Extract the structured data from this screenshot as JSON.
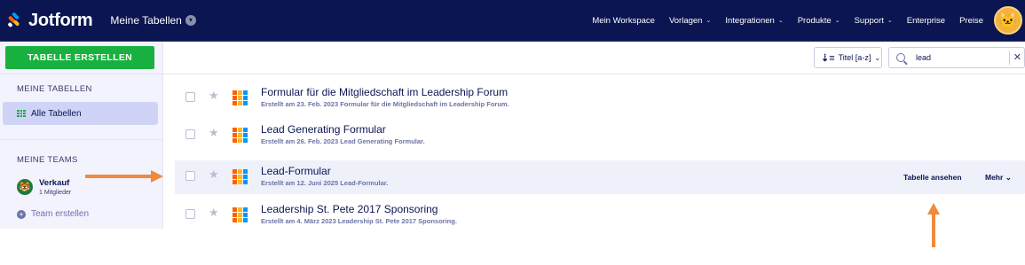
{
  "header": {
    "logo_text": "Jotform",
    "breadcrumb": "Meine Tabellen",
    "nav": [
      "Mein Workspace",
      "Vorlagen",
      "Integrationen",
      "Produkte",
      "Support",
      "Enterprise",
      "Preise"
    ],
    "nav_dropdown": [
      false,
      true,
      true,
      true,
      true,
      false,
      false
    ]
  },
  "sidebar": {
    "create_button": "TABELLE ERSTELLEN",
    "my_tables_heading": "MEINE TABELLEN",
    "all_tables_label": "Alle Tabellen",
    "my_teams_heading": "MEINE TEAMS",
    "team_name": "Verkauf",
    "team_members": "1 Mitglieder",
    "create_team_label": "Team erstellen"
  },
  "toolbar": {
    "sort_label": "Titel [a-z]",
    "search_value": "lead"
  },
  "rows": [
    {
      "title": "Formular für die Mitgliedschaft im Leadership Forum",
      "subtitle": "Erstellt am 23. Feb. 2023 Formular für die Mitgliedschaft im Leadership Forum."
    },
    {
      "title": "Lead Generating Formular",
      "subtitle": "Erstellt am 26. Feb. 2023 Lead Generating Formular."
    },
    {
      "title": "Lead-Formular",
      "subtitle": "Erstellt am 12. Juni 2025 Lead-Formular."
    },
    {
      "title": "Leadership St. Pete 2017 Sponsoring",
      "subtitle": "Erstellt am 4. März 2023 Leadership St. Pete 2017 Sponsoring."
    }
  ],
  "row_actions": {
    "view_label": "Tabelle ansehen",
    "more_label": "Mehr"
  },
  "colors": {
    "header_bg": "#0a1551",
    "accent_green": "#18b13f",
    "annotation_arrow": "#f08a3c"
  }
}
